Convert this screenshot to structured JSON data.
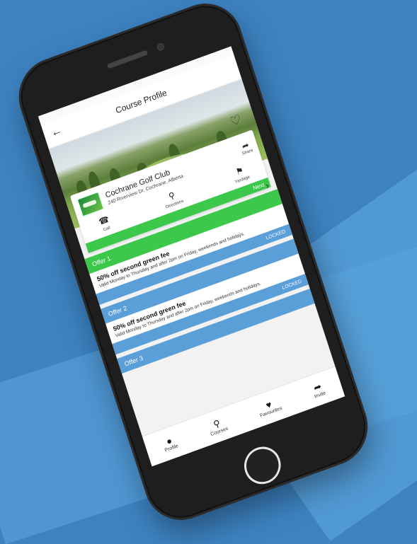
{
  "screen": {
    "title": "Course Profile"
  },
  "club": {
    "name": "Cochrane Golf Club",
    "address": "240 Riverview Dr, Cochrane, Alberta",
    "share_label": "Share"
  },
  "actions": [
    {
      "label": "Call",
      "icon": "phone-icon"
    },
    {
      "label": "Directions",
      "icon": "location-pin-icon"
    },
    {
      "label": "Yardage",
      "icon": "flag-icon"
    }
  ],
  "next_label": "Next",
  "offers": [
    {
      "header": "Offer 1",
      "title": "50% off second green fee",
      "description": "Valid Monday to Thursday and after 2pm on Friday, weekends and holidays.",
      "status": "LOCKED"
    },
    {
      "header": "Offer 2",
      "title": "50% off second green fee",
      "description": "Valid Monday to Thursday and after 2pm on Friday, weekends and holidays.",
      "status": "LOCKED"
    },
    {
      "header": "Offer 3"
    }
  ],
  "bottom_nav": [
    {
      "label": "Profile",
      "icon": "person-icon"
    },
    {
      "label": "Courses",
      "icon": "map-pin-icon"
    },
    {
      "label": "Favourites",
      "icon": "heart-icon"
    },
    {
      "label": "Invite",
      "icon": "share-arrow-icon"
    }
  ],
  "colors": {
    "background": "#3d83c2",
    "green": "#3cc84b",
    "blue": "#5b9fd9"
  }
}
